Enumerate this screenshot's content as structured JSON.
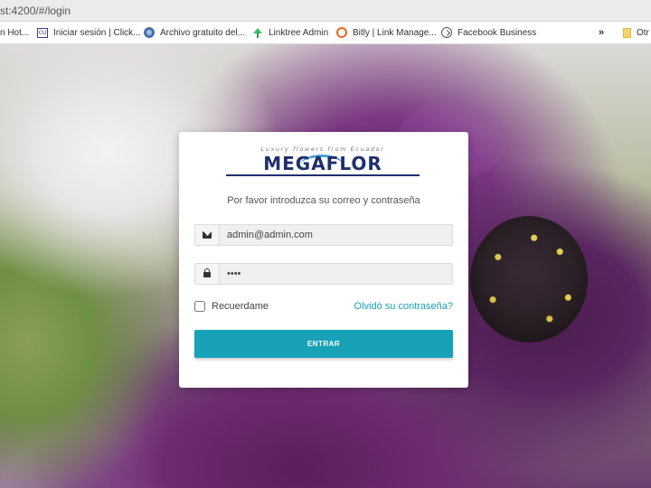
{
  "browser": {
    "url": "st:4200/#/login",
    "bookmarks": [
      {
        "label": "n Hot...",
        "icon": "none"
      },
      {
        "label": "Iniciar sesión | Click...",
        "icon": "clickup-icon"
      },
      {
        "label": "Archivo gratuito del...",
        "icon": "globe-icon"
      },
      {
        "label": "Linktree Admin",
        "icon": "linktree-icon"
      },
      {
        "label": "Bitly | Link Manage...",
        "icon": "bitly-icon"
      },
      {
        "label": "Facebook Business",
        "icon": "facebook-business-icon"
      }
    ],
    "overflow_label": "»",
    "other_label": "Otr"
  },
  "login": {
    "logo_tagline": "Luxury flowers from Ecuador",
    "logo_text": "MEGAFLOR",
    "subtitle": "Por favor introduzca su correo y contraseña",
    "email_value": "admin@admin.com",
    "password_value": "••••",
    "remember_label": "Recuerdame",
    "forgot_label": "Olvidó su contraseña?",
    "submit_label": "ENTRAR"
  },
  "colors": {
    "accent": "#17a2b8",
    "link": "#1aa0b9",
    "logo_blue": "#1f2f6e"
  }
}
